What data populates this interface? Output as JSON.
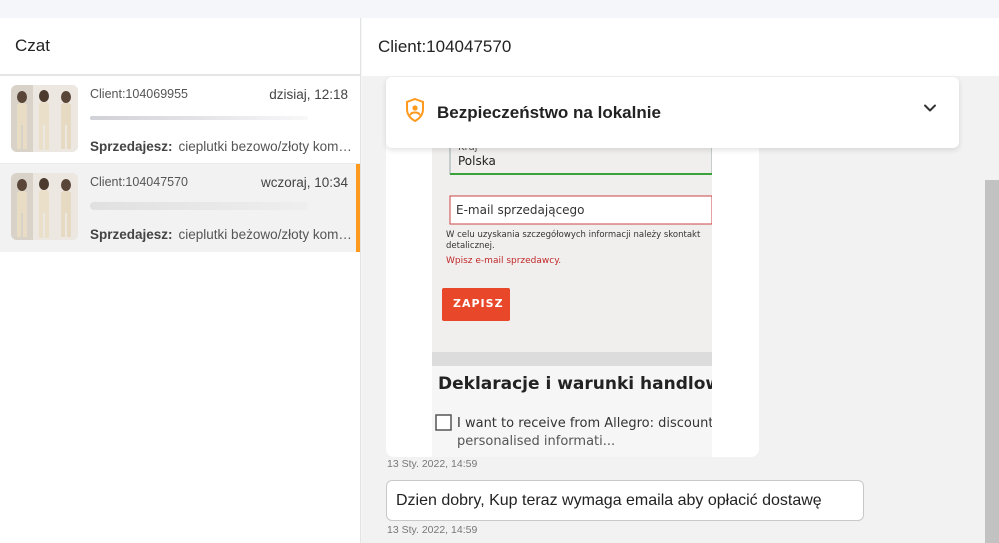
{
  "left": {
    "title": "Czat",
    "conversations": [
      {
        "client": "Client:104069955",
        "time": "dzisiaj, 12:18",
        "seller_label": "Sprzedajesz:",
        "seller_item": "cieplutki bezowo/złoty komp…",
        "active": false
      },
      {
        "client": "Client:104047570",
        "time": "wczoraj, 10:34",
        "seller_label": "Sprzedajesz:",
        "seller_item": "cieplutki beżowo/złoty komp…",
        "active": true
      }
    ]
  },
  "chat": {
    "title": "Client:104047570",
    "banner": {
      "title": "Bezpieczeństwo na lokalnie",
      "icon": "shield-user-icon",
      "chevron": "chevron-down-icon",
      "accent": "#ff9a1f"
    },
    "image_message": {
      "timestamp": "13 Sty. 2022, 14:59",
      "photo": {
        "country_label": "Kraj",
        "country_value": "Polska",
        "email_placeholder": "E-mail sprzedającego",
        "info_text": "W celu uzyskania szczegółowych informacji należy skontakt",
        "info_text2": "detalicznej.",
        "error_text": "Wpisz e-mail sprzedawcy.",
        "save_button": "ZAPISZ",
        "section_title": "Deklaracje i warunki handlowe",
        "checkbox_text": "I want to receive from Allegro: discount codes,",
        "checkbox_text2": "personalised informati..."
      }
    },
    "text_message": {
      "text": "Dzien dobry, Kup teraz wymaga emaila aby opłacić dostawę",
      "timestamp": "13 Sty. 2022, 14:59"
    }
  }
}
